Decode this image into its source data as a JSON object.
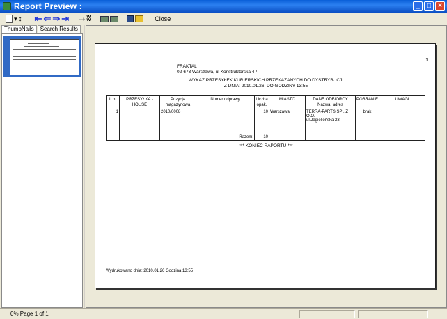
{
  "window": {
    "title": "Report Preview :"
  },
  "toolbar": {
    "close_label": "Close"
  },
  "tabs": [
    "ThumbNails",
    "Search Results"
  ],
  "status": {
    "text": "0%  Page 1 of 1"
  },
  "report": {
    "page_number": "1",
    "company": "FRAKTAL",
    "address": "02-673 Warszawa, ul Konstruktorska 4 /",
    "title": "WYKAZ PRZESYŁEK KURIERSKICH PRZEKAZANYCH DO DYSTRYBUCJI",
    "date_line": "Z DNIA: 2010.01.26, DO GODZINY 13:55",
    "columns": [
      "L.p.",
      "PRZESYŁKA - HOUSE",
      "Pozycja magazynowa",
      "Numer odprawy",
      "Liczba opak.",
      "MIASTO",
      "DANE ODBIORCY Nazwa, adres",
      "POBRANIE",
      "UWAGI"
    ],
    "row": {
      "lp": "1",
      "house": "",
      "pozycja": "2010/0008",
      "numer": "",
      "liczba": "10",
      "miasto": "Warszawa",
      "odbiorca_1": "TERRA-PARTS SP . Z",
      "odbiorca_2": "O.O.",
      "odbiorca_3": "ul.Jagiellońska 23",
      "pobranie": "brak",
      "uwagi": ""
    },
    "total_label": "Razem:",
    "total_value": "10",
    "end_text": "*** KONIEC RAPORTU ***",
    "printed_line": "Wydrukowano dnia: 2010.01.26 Godzina 13:55"
  }
}
